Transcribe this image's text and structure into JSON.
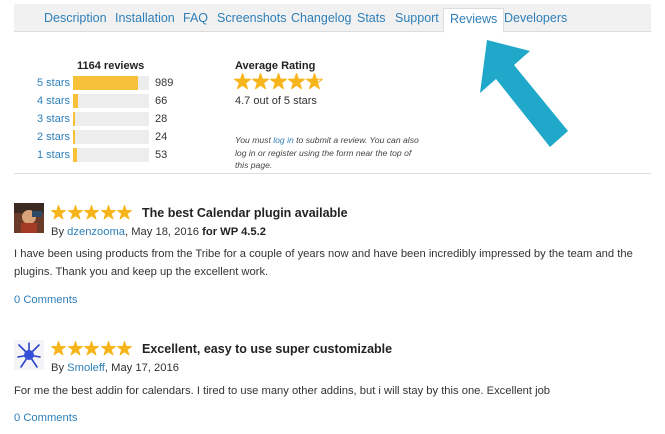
{
  "tabs": [
    {
      "label": "Description"
    },
    {
      "label": "Installation"
    },
    {
      "label": "FAQ"
    },
    {
      "label": "Screenshots"
    },
    {
      "label": "Changelog"
    },
    {
      "label": "Stats"
    },
    {
      "label": "Support"
    },
    {
      "label": "Reviews",
      "active": true
    },
    {
      "label": "Developers"
    }
  ],
  "summary": {
    "reviews_count": "1164 reviews",
    "rows": [
      {
        "label": "5 stars",
        "count": "989",
        "fraction": 0.85
      },
      {
        "label": "4 stars",
        "count": "66",
        "fraction": 0.06
      },
      {
        "label": "3 stars",
        "count": "28",
        "fraction": 0.03
      },
      {
        "label": "2 stars",
        "count": "24",
        "fraction": 0.03
      },
      {
        "label": "1 stars",
        "count": "53",
        "fraction": 0.05
      }
    ],
    "average_title": "Average Rating",
    "average_stars": 4.7,
    "average_text": "4.7 out of 5 stars",
    "note_before": "You must ",
    "note_link": "log in",
    "note_after": " to submit a review. You can also log in or register using the form near the top of this page."
  },
  "reviews": [
    {
      "stars": 5,
      "title": "The best Calendar plugin available",
      "by": "By ",
      "author": "dzenzooma",
      "date": ", May 18, 2016 ",
      "wp": "for WP 4.5.2",
      "body": "I have been using products from the Tribe for a couple of years now and have been incredibly impressed by the team and the plugins. Thank you and keep up the excellent work.",
      "comments": "0 Comments"
    },
    {
      "stars": 5,
      "title": "Excellent, easy to use super customizable",
      "by": "By ",
      "author": "Smoleff",
      "date": ", May 17, 2016",
      "wp": "",
      "body": "For me the best addin for calendars. I tired to use many other addins, but i will stay by this one. Excellent job",
      "comments": "0 Comments"
    }
  ],
  "colors": {
    "accent": "#2e7fb8",
    "star": "#f7b51c",
    "arrow": "#1fa8c9",
    "bar": "#f7c23a"
  }
}
